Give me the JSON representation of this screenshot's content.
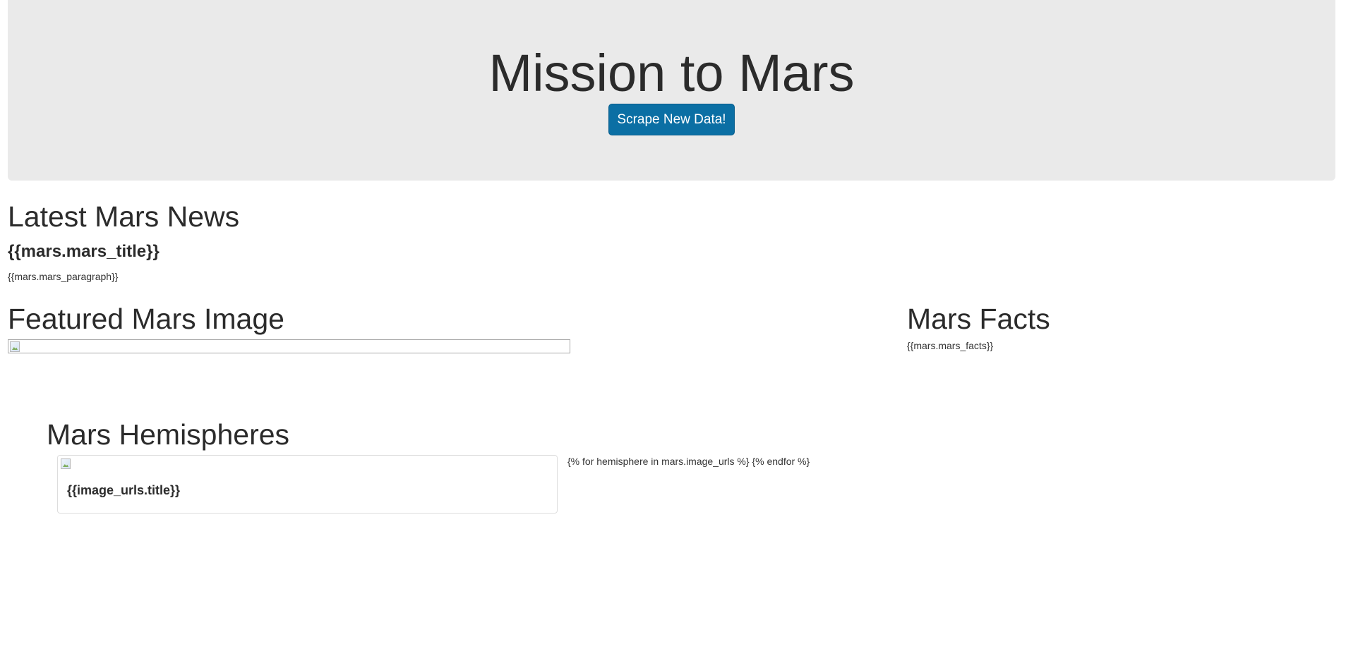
{
  "header": {
    "title": "Mission to Mars",
    "scrape_button": "Scrape New Data!"
  },
  "news": {
    "heading": "Latest Mars News",
    "title": "{{mars.mars_title}}",
    "paragraph": "{{mars.mars_paragraph}}"
  },
  "featured": {
    "heading": "Featured Mars Image"
  },
  "facts": {
    "heading": "Mars Facts",
    "content": "{{mars.mars_facts}}"
  },
  "hemispheres": {
    "heading": "Mars Hemispheres",
    "item_title": "{{image_urls.title}}",
    "loop_text": "{% for hemisphere in mars.image_urls %} {% endfor %}"
  },
  "colors": {
    "jumbotron_bg": "#eaeaea",
    "button_bg": "#0b6fa4",
    "text": "#333333"
  }
}
